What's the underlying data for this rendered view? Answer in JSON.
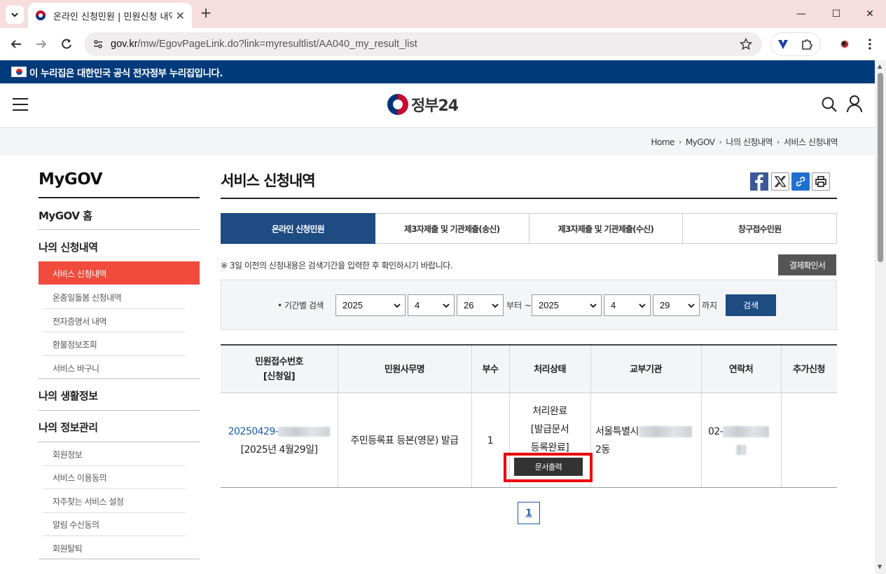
{
  "browser": {
    "tab_title": "온라인 신청민원 | 민원신청 내역",
    "url_host": "gov.kr",
    "url_path": "/mw/EgovPageLink.do?link=myresultlist/AA040_my_result_list"
  },
  "govbar": {
    "text": "이 누리집은 대한민국 공식 전자정부 누리집입니다."
  },
  "header": {
    "logo_text": "정부24"
  },
  "breadcrumb": [
    "Home",
    "MyGOV",
    "나의 신청내역",
    "서비스 신청내역"
  ],
  "sidebar": {
    "title": "MyGOV",
    "home": "MyGOV 홈",
    "section1": "나의 신청내역",
    "section1_items": [
      "서비스 신청내역",
      "온종일돌봄 신청내역",
      "전자증명서 내역",
      "환불정보조회",
      "서비스 바구니"
    ],
    "section2": "나의 생활정보",
    "section3": "나의 정보관리",
    "section3_items": [
      "회원정보",
      "서비스 이용동의",
      "자주찾는 서비스 설정",
      "알림 수신동의",
      "회원탈퇴"
    ]
  },
  "main": {
    "title": "서비스 신청내역",
    "tabs": [
      "온라인 신청민원",
      "제3자제출 및 기관제출(송신)",
      "제3자제출 및 기관제출(수신)",
      "창구접수민원"
    ],
    "notice": "※ 3일 이전의 신청내용은 검색기간을 입력한 후 확인하시기 바랍니다.",
    "receipt_button": "결제확인서"
  },
  "search": {
    "label": "• 기간별 검색",
    "from_year": "2025",
    "from_month": "4",
    "from_day": "26",
    "from_suffix": "부터 ~",
    "to_year": "2025",
    "to_month": "4",
    "to_day": "29",
    "to_suffix": "까지",
    "button": "검색"
  },
  "table": {
    "headers": [
      "민원접수번호",
      "[신청일]",
      "민원사무명",
      "부수",
      "처리상태",
      "교부기관",
      "연락처",
      "추가신청"
    ],
    "row": {
      "receipt_no": "20250429-",
      "date": "[2025년 4월29일]",
      "name": "주민등록표 등본(영문) 발급",
      "copies": "1",
      "status_line1": "처리완료",
      "status_line2": "[발급문서",
      "status_line3": "등록완료]",
      "print_button": "문서출력",
      "agency_prefix": "서울특별시",
      "agency_suffix": "2동",
      "contact_prefix": "02-"
    }
  },
  "pagination": {
    "current": "1"
  }
}
